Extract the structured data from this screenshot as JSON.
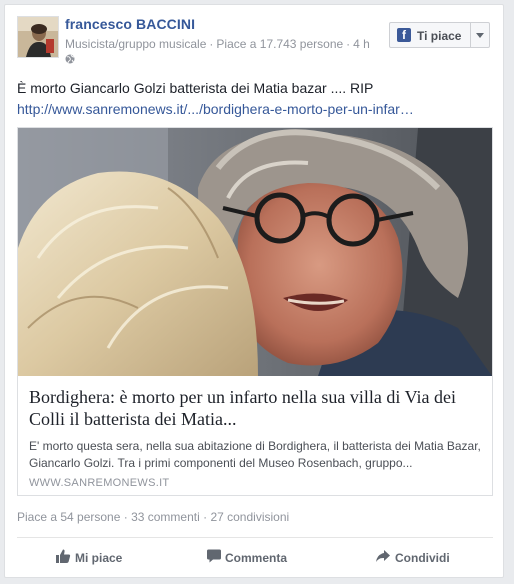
{
  "post": {
    "page_name": "francesco BACCINI",
    "category": "Musicista/gruppo musicale",
    "likes_count": "Piace a 17.743 persone",
    "time": "4 h",
    "text": "È morto Giancarlo Golzi batterista dei Matia bazar .... RIP",
    "link": "http://www.sanremonews.it/.../bordighera-e-morto-per-un-infar…"
  },
  "page_like_button": {
    "label": "Ti piace"
  },
  "attachment": {
    "title": "Bordighera: è morto per un infarto nella sua villa di Via dei Colli il batterista dei Matia...",
    "description": "E' morto questa sera, nella sua abitazione di Bordighera, il batterista dei Matia Bazar, Giancarlo Golzi. Tra i primi componenti del Museo Rosenbach, gruppo...",
    "domain": "WWW.SANREMONEWS.IT"
  },
  "stats": {
    "likes": "Piace a 54 persone",
    "comments": "33 commenti",
    "shares": "27 condivisioni"
  },
  "actions": {
    "like": "Mi piace",
    "comment": "Commenta",
    "share": "Condividi"
  },
  "colors": {
    "link": "#365899",
    "facebook_blue": "#3b5998",
    "meta_grey": "#90949c"
  },
  "icons": [
    "globe-icon",
    "facebook-f-icon",
    "chevron-down-icon",
    "thumbs-up-icon",
    "comment-icon",
    "share-icon"
  ]
}
